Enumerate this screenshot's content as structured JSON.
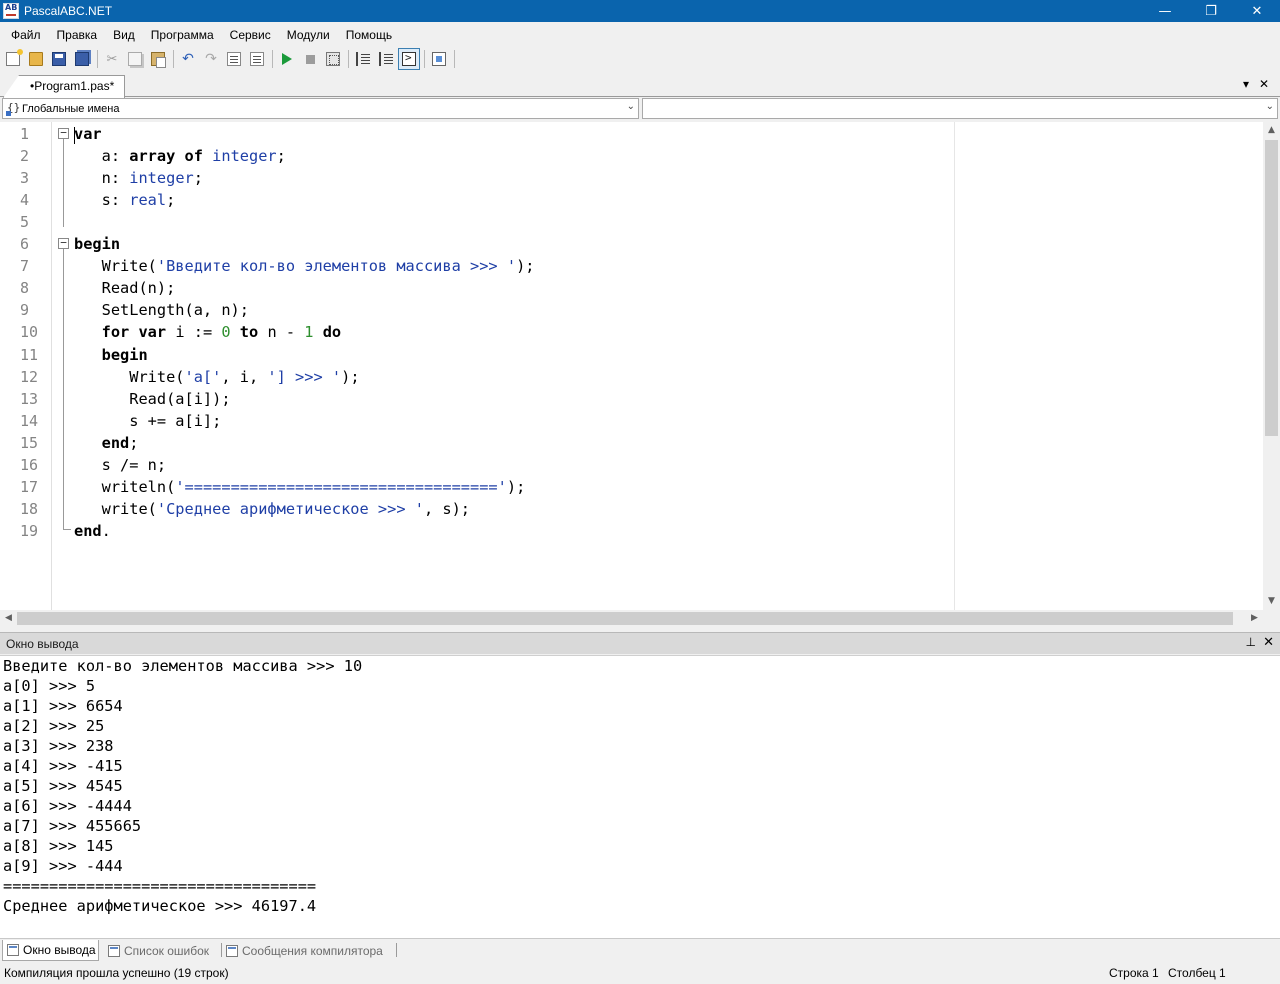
{
  "window": {
    "title": "PascalABC.NET",
    "minimize_glyph": "—",
    "maximize_glyph": "❐",
    "close_glyph": "✕"
  },
  "menu": [
    "Файл",
    "Правка",
    "Вид",
    "Программа",
    "Сервис",
    "Модули",
    "Помощь"
  ],
  "toolbar_icons": [
    "new-file-icon",
    "open-file-icon",
    "save-icon",
    "save-all-icon",
    "cut-icon",
    "copy-icon",
    "paste-icon",
    "undo-icon",
    "redo-icon",
    "nav-back-icon",
    "nav-forward-icon",
    "run-icon",
    "stop-icon",
    "compile-icon",
    "step-into-icon",
    "step-over-icon",
    "console-window-icon",
    "debug-window-icon"
  ],
  "editor_tab": {
    "label": "•Program1.pas*",
    "dropdown_glyph": "▾",
    "close_glyph": "✕"
  },
  "combos": {
    "left_text": "Глобальные имена",
    "right_text": "",
    "arrow_glyph": "⌄"
  },
  "code": {
    "line_numbers": [
      "1",
      "2",
      "3",
      "4",
      "5",
      "6",
      "7",
      "8",
      "9",
      "10",
      "11",
      "12",
      "13",
      "14",
      "15",
      "16",
      "17",
      "18",
      "19"
    ],
    "lines": [
      [
        [
          "kw",
          "var"
        ]
      ],
      [
        [
          "",
          "   a: "
        ],
        [
          "kw",
          "array of"
        ],
        [
          "ty",
          " integer"
        ],
        [
          "",
          ";"
        ]
      ],
      [
        [
          "",
          "   n: "
        ],
        [
          "ty",
          "integer"
        ],
        [
          "",
          ";"
        ]
      ],
      [
        [
          "",
          "   s: "
        ],
        [
          "ty",
          "real"
        ],
        [
          "",
          ";"
        ]
      ],
      [],
      [
        [
          "kw",
          "begin"
        ]
      ],
      [
        [
          "",
          "   Write("
        ],
        [
          "st",
          "'Введите кол-во элементов массива >>> '"
        ],
        [
          "",
          ");"
        ]
      ],
      [
        [
          "",
          "   Read(n);"
        ]
      ],
      [
        [
          "",
          "   SetLength(a, n);"
        ]
      ],
      [
        [
          "kw",
          "   for var"
        ],
        [
          "",
          " i := "
        ],
        [
          "nu",
          "0"
        ],
        [
          "kw",
          " to"
        ],
        [
          "",
          " n - "
        ],
        [
          "nu",
          "1"
        ],
        [
          "kw",
          " do"
        ]
      ],
      [
        [
          "kw",
          "   begin"
        ]
      ],
      [
        [
          "",
          "      Write("
        ],
        [
          "st",
          "'a['"
        ],
        [
          "",
          ", i, "
        ],
        [
          "st",
          "'] >>> '"
        ],
        [
          "",
          ");"
        ]
      ],
      [
        [
          "",
          "      Read(a[i]);"
        ]
      ],
      [
        [
          "",
          "      s += a[i];"
        ]
      ],
      [
        [
          "kw",
          "   end"
        ],
        [
          "",
          ";"
        ]
      ],
      [
        [
          "",
          "   s /= n;"
        ]
      ],
      [
        [
          "",
          "   writeln("
        ],
        [
          "st",
          "'=================================='"
        ],
        [
          "",
          ");"
        ]
      ],
      [
        [
          "",
          "   write("
        ],
        [
          "st",
          "'Среднее арифметическое >>> '"
        ],
        [
          "",
          ", s);"
        ]
      ],
      [
        [
          "kw",
          "end"
        ],
        [
          "",
          "."
        ]
      ]
    ]
  },
  "output_panel": {
    "title": "Окно вывода",
    "pin_glyph": "⊥",
    "close_glyph": "✕",
    "lines": [
      "Введите кол-во элементов массива >>> 10",
      "a[0] >>> 5",
      "a[1] >>> 6654",
      "a[2] >>> 25",
      "a[3] >>> 238",
      "a[4] >>> -415",
      "a[5] >>> 4545",
      "a[6] >>> -4444",
      "a[7] >>> 455665",
      "a[8] >>> 145",
      "a[9] >>> -444",
      "==================================",
      "Среднее арифметическое >>> 46197.4"
    ]
  },
  "bottom_tabs": [
    {
      "label": "Окно вывода",
      "active": true
    },
    {
      "label": "Список ошибок",
      "active": false
    },
    {
      "label": "Сообщения компилятора",
      "active": false
    }
  ],
  "status": {
    "message": "Компиляция прошла успешно (19 строк)",
    "row": "Строка   1",
    "col": "Столбец   1"
  }
}
